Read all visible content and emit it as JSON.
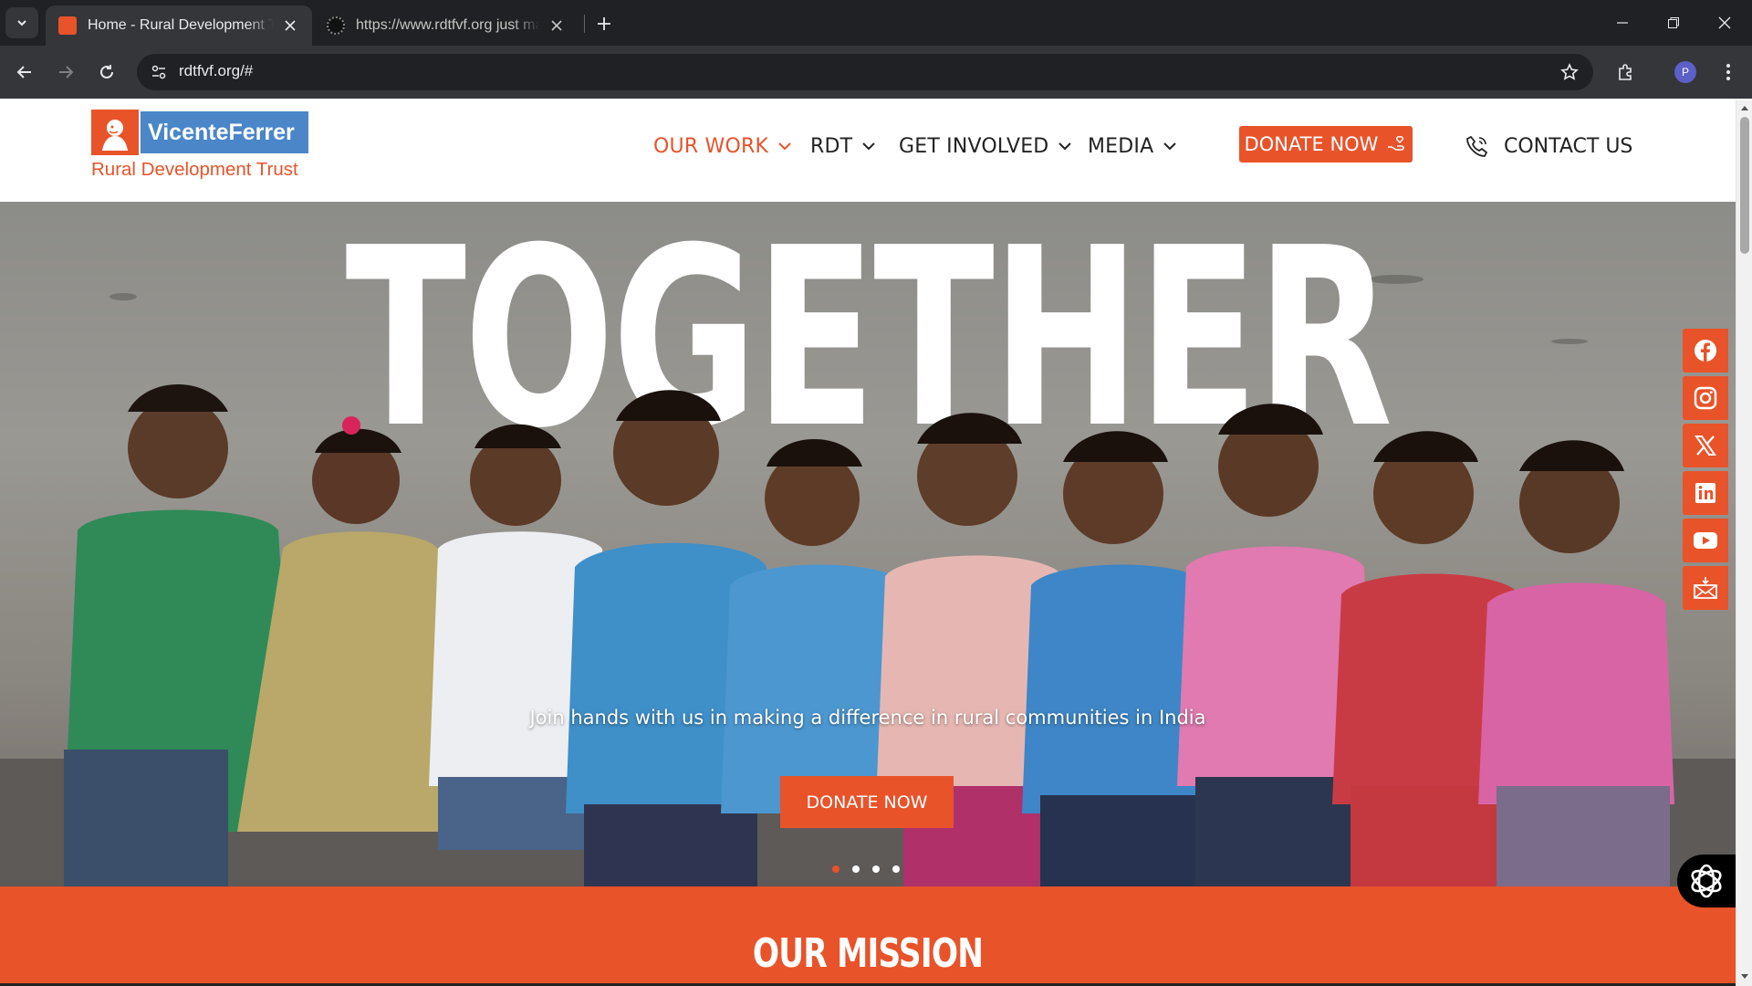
{
  "browser": {
    "tabs": [
      {
        "title": "Home - Rural Development Trust",
        "active": true
      },
      {
        "title": "https://www.rdtfvf.org just make",
        "active": false
      }
    ],
    "url": "rdtfvf.org/#",
    "profile_initial": "P"
  },
  "site": {
    "logo": {
      "name": "VicenteFerrer",
      "subtitle": "Rural Development Trust"
    },
    "nav": [
      {
        "label": "OUR WORK",
        "active": true
      },
      {
        "label": "RDT",
        "active": false
      },
      {
        "label": "GET INVOLVED",
        "active": false
      },
      {
        "label": "MEDIA",
        "active": false
      }
    ],
    "donate_label": "DONATE NOW",
    "contact_label": "CONTACT US",
    "accent_color": "#e8532a"
  },
  "hero": {
    "title": "TOGETHER",
    "subtitle": "Join hands with us in making a difference in rural communities in India",
    "button_label": "DONATE NOW",
    "slides_count": 4,
    "active_slide": 1
  },
  "social": [
    "facebook-icon",
    "instagram-icon",
    "x-icon",
    "linkedin-icon",
    "youtube-icon",
    "email-icon"
  ],
  "mission": {
    "title": "OUR MISSION"
  }
}
